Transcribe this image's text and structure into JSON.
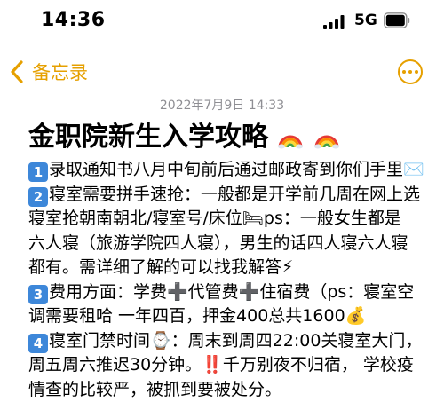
{
  "status_bar": {
    "time": "14:36",
    "network": "5G"
  },
  "nav": {
    "back_label": "备忘录",
    "accent_color": "#e6a000"
  },
  "note": {
    "timestamp": "2022年7月9日 14:33",
    "title": "金职院新生入学攻略",
    "title_icons": [
      "rainbow-icon",
      "rainbow-icon"
    ],
    "lines": [
      "录取通知书八月中旬前后通过邮政寄到你们手里✉️",
      "寝室需要拼手速抢：一般都是开学前几周在网上选",
      "寝室抢朝南朝北/寝室号/床位🛏ps：一般女生都是",
      "六人寝（旅游学院四人寝），男生的话四人寝六人寝",
      "都有。需详细了解的可以找我解答⚡",
      "费用方面：学费➕代管费➕住宿费（ps：寝室空",
      "调需要租哈 一年四百，押金400总共1600💰",
      "寝室门禁时间⌚：周末到周四22:00关寝室大门，",
      "周五周六推迟30分钟。‼️千万别夜不归宿，  学校疫",
      "情查的比较严，被抓到要被处分。"
    ],
    "number_badges": [
      "1",
      "2",
      "3",
      "4"
    ],
    "badge_color": "#3d87d9"
  }
}
